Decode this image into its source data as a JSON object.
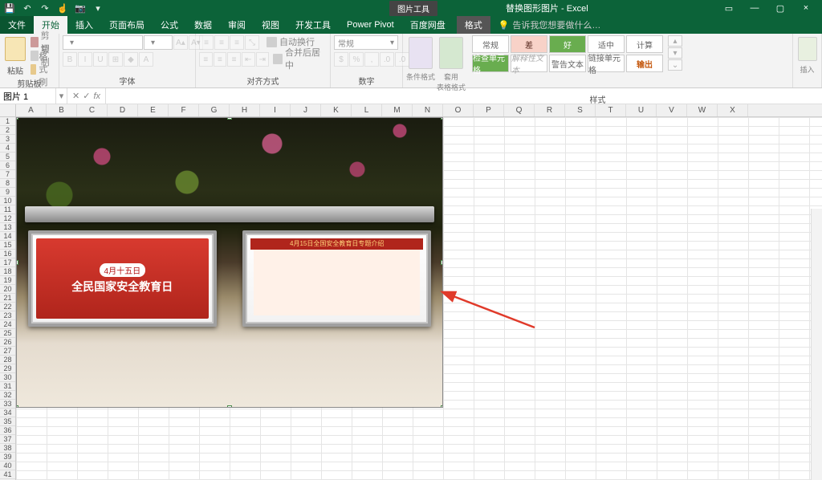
{
  "titlebar": {
    "qat_icons": [
      "save",
      "undo",
      "redo",
      "touch",
      "camera"
    ],
    "contextual_label": "图片工具",
    "doc_title": "替换图形图片 - Excel",
    "win": [
      "▢",
      "×"
    ]
  },
  "tabs": {
    "file": "文件",
    "items": [
      "开始",
      "插入",
      "页面布局",
      "公式",
      "数据",
      "审阅",
      "视图",
      "开发工具",
      "Power Pivot",
      "百度网盘"
    ],
    "context_tab": "格式",
    "active_index": 0,
    "tellme_placeholder": "告诉我您想要做什么…",
    "tellme_icon": "💡"
  },
  "ribbon": {
    "clipboard": {
      "label": "剪贴板",
      "paste": "粘贴",
      "cut": "剪切",
      "copy": "复制",
      "format_painter": "格式刷"
    },
    "font": {
      "label": "字体",
      "name": "",
      "size": "",
      "buttons": [
        "B",
        "I",
        "U",
        "⊞",
        "◆",
        "A"
      ]
    },
    "align": {
      "label": "对齐方式",
      "wrap": "自动换行",
      "merge": "合并后居中"
    },
    "number": {
      "label": "数字",
      "format": "常规"
    },
    "styles": {
      "label": "样式",
      "cond": "条件格式",
      "table": "套用\n表格格式",
      "cells": [
        {
          "t": "常规",
          "cls": ""
        },
        {
          "t": "差",
          "cls": "warn"
        },
        {
          "t": "好",
          "cls": "green"
        },
        {
          "t": "适中",
          "cls": ""
        },
        {
          "t": "计算",
          "cls": ""
        },
        {
          "t": "检查单元格",
          "cls": "green"
        },
        {
          "t": "解释性文本",
          "cls": "ital"
        },
        {
          "t": "警告文本",
          "cls": ""
        },
        {
          "t": "链接单元格",
          "cls": ""
        },
        {
          "t": "输出",
          "cls": "out"
        }
      ]
    },
    "insert": {
      "label": "",
      "btn": "插入"
    }
  },
  "formula_bar": {
    "name_box": "图片 1",
    "fx": "fx",
    "value": ""
  },
  "grid": {
    "columns": [
      "A",
      "B",
      "C",
      "D",
      "E",
      "F",
      "G",
      "H",
      "I",
      "J",
      "K",
      "L",
      "M",
      "N",
      "O",
      "P",
      "Q",
      "R",
      "S",
      "T",
      "U",
      "V",
      "W",
      "X"
    ],
    "row_count": 41
  },
  "picture": {
    "panel_left_date": "4月十五日",
    "panel_left_title": "全民国家安全教育日",
    "panel_right_header": "4月15日全国安全教育日专题介绍"
  }
}
